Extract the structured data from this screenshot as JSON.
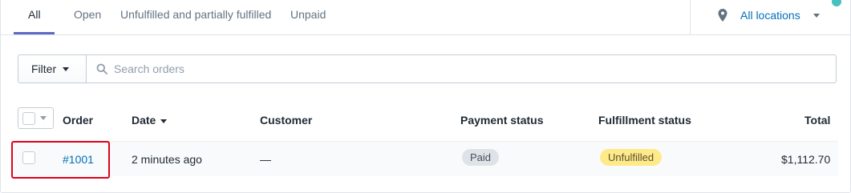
{
  "tabs": [
    {
      "label": "All",
      "active": true
    },
    {
      "label": "Open"
    },
    {
      "label": "Unfulfilled and partially fulfilled"
    },
    {
      "label": "Unpaid"
    }
  ],
  "location": {
    "label": "All locations",
    "icon": "location-pin-icon"
  },
  "filter": {
    "label": "Filter"
  },
  "search": {
    "placeholder": "Search orders",
    "value": ""
  },
  "table": {
    "columns": {
      "order": "Order",
      "date": "Date",
      "customer": "Customer",
      "payment": "Payment status",
      "fulfillment": "Fulfillment status",
      "total": "Total"
    },
    "rows": [
      {
        "order": "#1001",
        "date": "2 minutes ago",
        "customer": "—",
        "payment": "Paid",
        "fulfillment": "Unfulfilled",
        "total": "$1,112.70"
      }
    ]
  },
  "colors": {
    "accent": "#5c6ac4",
    "link": "#006fbb",
    "highlight": "#e0001a",
    "unfulfilled": "#ffea8a",
    "paid": "#dfe3e8"
  }
}
